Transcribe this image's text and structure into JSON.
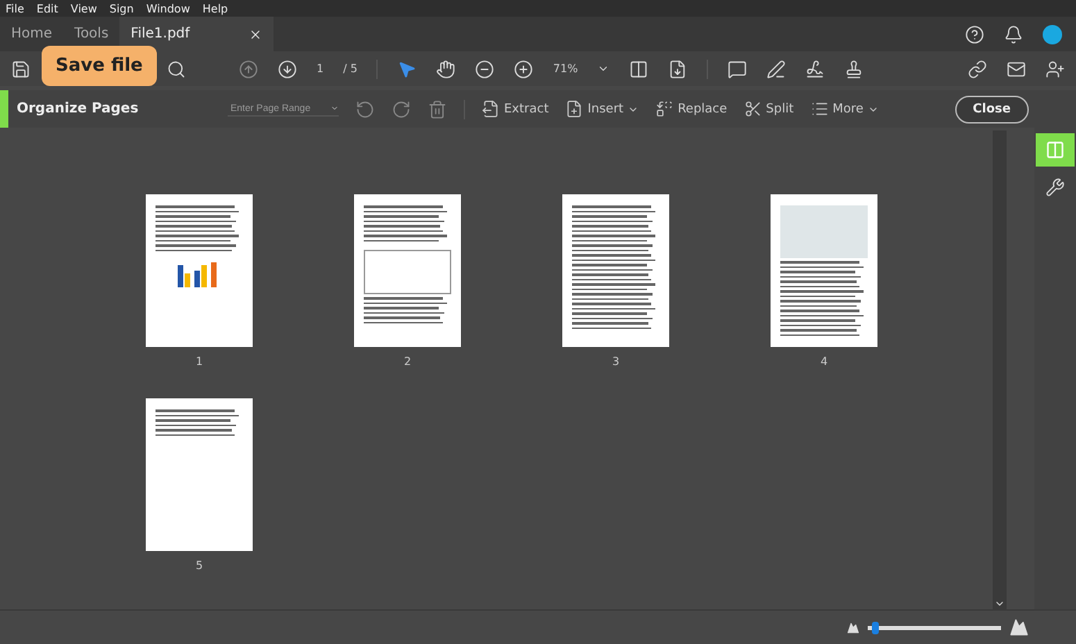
{
  "menu": [
    "File",
    "Edit",
    "View",
    "Sign",
    "Window",
    "Help"
  ],
  "tabs": [
    {
      "label": "Home",
      "selected": false
    },
    {
      "label": "Tools",
      "selected": false
    },
    {
      "label": "File1.pdf",
      "selected": true,
      "closable": true
    }
  ],
  "toolbar": {
    "tooltip": "Save file",
    "page_current": "1",
    "page_total": "/ 5",
    "zoom": "71%"
  },
  "organize": {
    "title": "Organize Pages",
    "range_placeholder": "Enter Page Range",
    "actions": [
      {
        "label": "Extract",
        "menu": false
      },
      {
        "label": "Insert",
        "menu": true
      },
      {
        "label": "Replace",
        "menu": false
      },
      {
        "label": "Split",
        "menu": false
      },
      {
        "label": "More",
        "menu": true
      }
    ],
    "close": "Close"
  },
  "pages": [
    {
      "number": "1",
      "kind": "chart"
    },
    {
      "number": "2",
      "kind": "table"
    },
    {
      "number": "3",
      "kind": "text"
    },
    {
      "number": "4",
      "kind": "photo"
    },
    {
      "number": "5",
      "kind": "short"
    }
  ],
  "thumbnail_size": {
    "level": 0.03
  }
}
